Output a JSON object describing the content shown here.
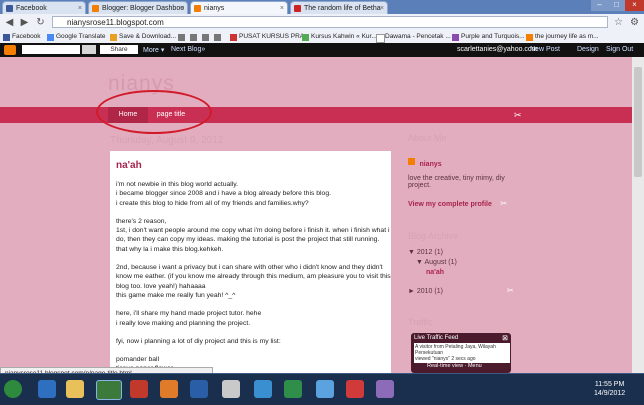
{
  "browser": {
    "tabs": [
      {
        "label": "Facebook",
        "favicon_color": "#3b5998"
      },
      {
        "label": "Blogger: Blogger Dashboo",
        "favicon_color": "#f57d00"
      },
      {
        "label": "nianys",
        "favicon_color": "#f57d00"
      },
      {
        "label": "The random life of Betha",
        "favicon_color": "#f57d00"
      }
    ],
    "url": "nianysrose11.blogspot.com",
    "bookmarks": [
      "Facebook",
      "Google Translate",
      "Save & Download...",
      "",
      "",
      "",
      "",
      "PUSAT KURSUS PRA...",
      "Kursus Kahwin « Kur...",
      "Dawama - Pencetak ...",
      "Purple and Turquois...",
      "the journey life as m..."
    ],
    "status_url": "nianysrose11.blogspot.com/p/page-title.html"
  },
  "blogger_bar": {
    "share": "Share",
    "more": "More ▾",
    "next_blog": "Next Blog»",
    "email": "scarlettanies@yahoo.com",
    "new_post": "New Post",
    "design": "Design",
    "sign_out": "Sign Out"
  },
  "blog": {
    "title": "nianys",
    "menu": [
      "Home",
      "page title"
    ],
    "date": "Thursday, August 9, 2012",
    "post": {
      "title": "na'ah",
      "paragraphs": [
        "i'm not newbie in this blog world actually.\ni became blogger since 2008 and i have a blog already before this blog.\ni create this blog to hide from all of my friends and families.why?",
        "there's 2 reason,\n1st, i don't want people around me copy what i'm doing before i finish it. when i finish what i do, then they can copy my ideas. making the tutorial is post the project that still running. that why la i make this blog.kehkeh.",
        "2nd, because i want a privacy but i can share with other who i didn't know and they didn't know me eather. (if you know me already through this medium, am pleasure you to visit this blog too. love yeah!) hahaaaa\nthis game make me really fun yeah! ^_^",
        "here, i'll share my hand made project tutor. hehe\ni really love making and planning the project.",
        "fyi, now i planning a lot of diy project and this is my list:",
        "pomander ball\ntissue paper flower"
      ]
    }
  },
  "sidebar": {
    "about_head": "About Me",
    "author": "nianys",
    "bio": "love the creative, tiny mimy, diy project.",
    "profile_link": "View my complete profile",
    "archive_head": "Blog Archive",
    "archive": [
      {
        "year": "▼ 2012",
        "count": "(1)"
      },
      {
        "month": "▼ August",
        "count": "(1)"
      },
      {
        "post": "na'ah"
      },
      {
        "year": "► 2010",
        "count": "(1)"
      }
    ],
    "traffic_head": "Traffic",
    "widget_title": "Live Traffic Feed",
    "widget_line1": "A visitor from Petaling Jaya, Wilayah Persekutuan",
    "widget_line2": "viewed \"nianys\" 2 secs ago",
    "widget_line3": "Real-time view · Menu"
  },
  "taskbar": {
    "time": "11:55 PM",
    "date": "14/9/2012"
  }
}
